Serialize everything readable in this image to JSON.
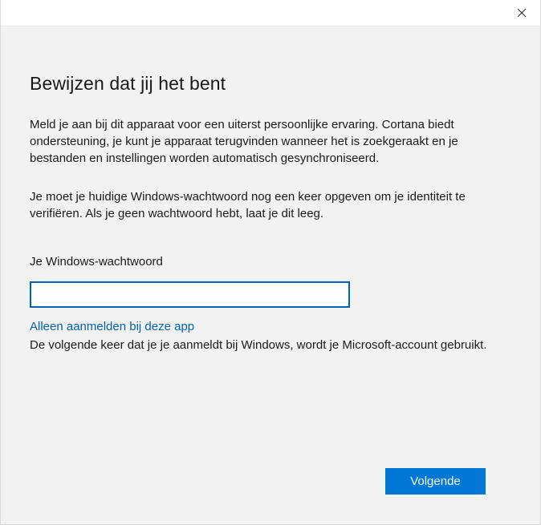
{
  "window": {
    "close_icon": "close-icon"
  },
  "main": {
    "title": "Bewijzen dat jij het bent",
    "intro_text": "Meld je aan bij dit apparaat voor een uiterst persoonlijke ervaring. Cortana biedt ondersteuning, je kunt je apparaat terugvinden wanneer het is zoekgeraakt en je bestanden en instellingen worden automatisch gesynchroniseerd.",
    "verify_text": "Je moet je huidige Windows-wachtwoord nog een keer opgeven om je identiteit te verifiëren. Als je geen wachtwoord hebt, laat je dit leeg.",
    "password_label": "Je Windows-wachtwoord",
    "password_value": "",
    "app_only_link": "Alleen aanmelden bij deze app",
    "note_text": "De volgende keer dat je je aanmeldt bij Windows, wordt je Microsoft-account gebruikt.",
    "next_button": "Volgende"
  },
  "colors": {
    "accent": "#0078d7",
    "link": "#0063b1",
    "content_background": "#f2f2f2"
  }
}
